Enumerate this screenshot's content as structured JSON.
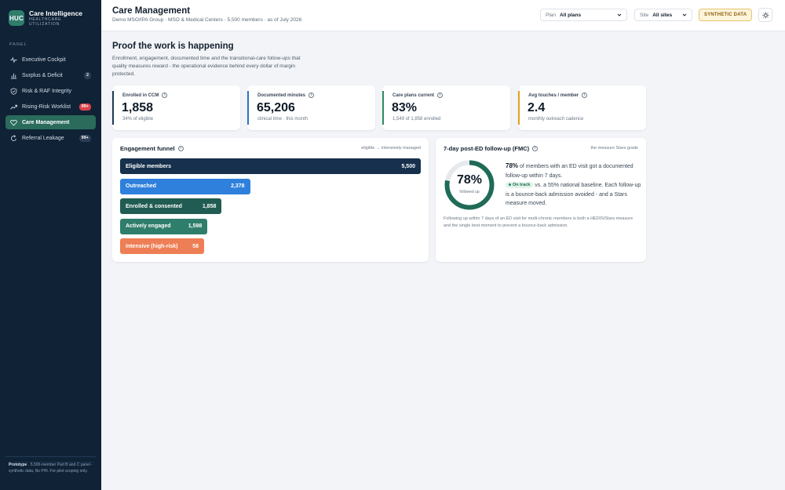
{
  "brand": {
    "logo": "HUC",
    "name": "Care Intelligence",
    "sub_line1": "HEALTHCARE",
    "sub_line2": "UTILIZATION"
  },
  "sidebar": {
    "panel_label": "PANEL",
    "items": [
      {
        "label": "Executive Cockpit",
        "icon": "pulse-icon",
        "badge": ""
      },
      {
        "label": "Surplus & Deficit",
        "icon": "bar-chart-icon",
        "badge": "2"
      },
      {
        "label": "Risk & RAF Integrity",
        "icon": "shield-check-icon",
        "badge": ""
      },
      {
        "label": "Rising-Risk Worklist",
        "icon": "trending-up-icon",
        "badge": "99+"
      },
      {
        "label": "Care Management",
        "icon": "heart-icon",
        "badge": ""
      },
      {
        "label": "Referral Leakage",
        "icon": "refresh-icon",
        "badge": "99+"
      }
    ],
    "footer_bold": "Prototype",
    "footer_text": " · 5,500-member Part B and C panel - synthetic data, No PHI. For pilot scoping only."
  },
  "header": {
    "title": "Care Management",
    "subtitle": "Demo MSO/IPA Group · MSO & Medical Centers  ·  5,500 members · as of July 2026",
    "plan_label": "Plan",
    "plan_value": "All plans",
    "site_label": "Site",
    "site_value": "All sites",
    "synthetic_badge": "SYNTHETIC DATA"
  },
  "main": {
    "title": "Proof the work is happening",
    "description": "Enrollment, engagement, documented time and the transitional-care follow-ups that quality measures reward - the operational evidence behind every dollar of margin protected."
  },
  "kpis": [
    {
      "label": "Enrolled in CCM",
      "value": "1,858",
      "sub": "34% of eligible",
      "color": "#1f3a57"
    },
    {
      "label": "Documented minutes",
      "value": "65,206",
      "sub": "clinical time · this month",
      "color": "#2d74c4"
    },
    {
      "label": "Care plans current",
      "value": "83%",
      "sub": "1,549 of 1,858 enrolled",
      "color": "#2f8a5e"
    },
    {
      "label": "Avg touches / member",
      "value": "2.4",
      "sub": "monthly outreach cadence",
      "color": "#e0a21f"
    }
  ],
  "funnel": {
    "title": "Engagement funnel",
    "note": "eligible → intensively managed",
    "max": 5500,
    "stages": [
      {
        "label": "Eligible members",
        "value": 5500,
        "display": "5,500",
        "color": "#16304d"
      },
      {
        "label": "Outreached",
        "value": 2378,
        "display": "2,378",
        "color": "#2f80dc"
      },
      {
        "label": "Enrolled & consented",
        "value": 1858,
        "display": "1,858",
        "color": "#215c52"
      },
      {
        "label": "Actively engaged",
        "value": 1598,
        "display": "1,598",
        "color": "#2f7d6b"
      },
      {
        "label": "Intensive (high-risk)",
        "value": 58,
        "display": "58",
        "color": "#ee7e55"
      }
    ]
  },
  "fmc": {
    "title": "7-day post-ED follow-up (FMC)",
    "note": "the measure Stars grade",
    "percent": 78,
    "percent_display": "78%",
    "donut_sub": "followed up",
    "lead_value": "78%",
    "lead_text": " of members with an ED visit got a documented follow-up within 7 days.",
    "pill": "On track",
    "detail": " vs. a 55% national baseline. Each follow-up is a bounce-back admission avoided - and a Stars measure moved.",
    "footnote": "Following up within 7 days of an ED visit for multi-chronic members is both a HEDIS/Stars measure and the single best moment to prevent a bounce-back admission.",
    "ring_color": "#1f6b57",
    "track_color": "#e6e9ed"
  }
}
